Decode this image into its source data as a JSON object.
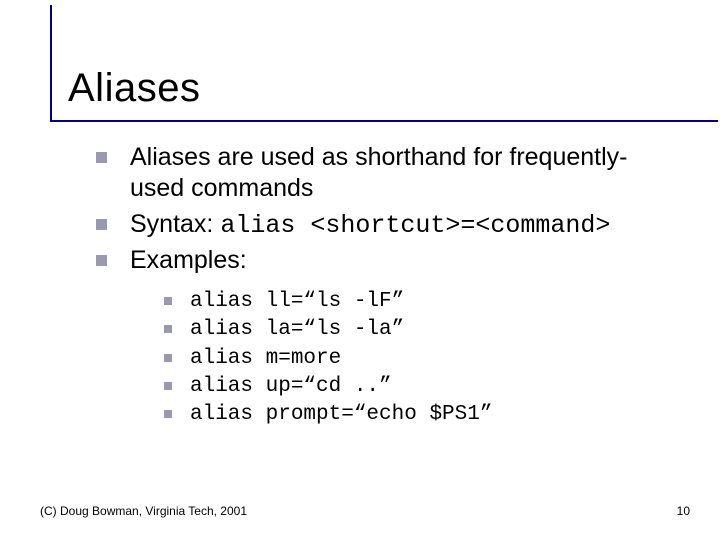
{
  "title": "Aliases",
  "bullets": {
    "b1": "Aliases are used as shorthand for frequently-used commands",
    "b2_prefix": "Syntax: ",
    "b2_code": "alias <shortcut>=<command>",
    "b3": "Examples:"
  },
  "examples": [
    "alias ll=“ls -lF”",
    "alias la=“ls -la”",
    "alias m=more",
    "alias up=“cd ..”",
    "alias prompt=“echo $PS1”"
  ],
  "footer": {
    "left": "(C) Doug Bowman, Virginia Tech, 2001",
    "right": "10"
  }
}
